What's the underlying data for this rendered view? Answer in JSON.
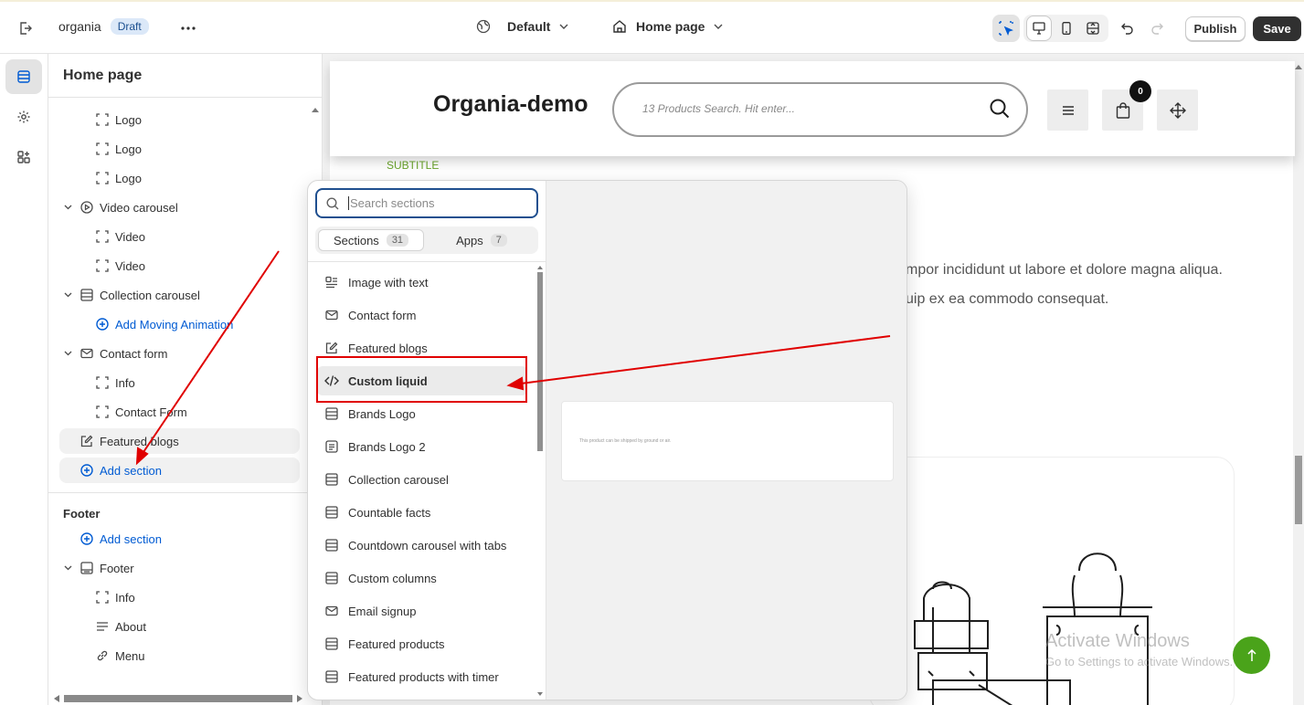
{
  "topbar": {
    "store_name": "organia",
    "status_badge": "Draft",
    "theme_selector": "Default",
    "page_selector": "Home page",
    "publish_label": "Publish",
    "save_label": "Save"
  },
  "sidebar": {
    "title": "Home page",
    "tree": [
      {
        "label": "Logo",
        "icon": "block-icon",
        "level": 2
      },
      {
        "label": "Logo",
        "icon": "block-icon",
        "level": 2
      },
      {
        "label": "Logo",
        "icon": "block-icon",
        "level": 2
      },
      {
        "label": "Video carousel",
        "icon": "play-circle-icon",
        "level": 1,
        "expanded": true
      },
      {
        "label": "Video",
        "icon": "block-icon",
        "level": 2
      },
      {
        "label": "Video",
        "icon": "block-icon",
        "level": 2
      },
      {
        "label": "Collection carousel",
        "icon": "section-icon",
        "level": 1,
        "expanded": true
      },
      {
        "label": "Add Moving Animation",
        "icon": "plus-circle-icon",
        "level": 2,
        "link": true
      },
      {
        "label": "Contact form",
        "icon": "mail-icon",
        "level": 1,
        "expanded": true
      },
      {
        "label": "Info",
        "icon": "block-icon",
        "level": 2
      },
      {
        "label": "Contact Form",
        "icon": "block-icon",
        "level": 2
      },
      {
        "label": "Featured blogs",
        "icon": "edit-icon",
        "level": 1
      },
      {
        "label": "Add section",
        "icon": "plus-circle-icon",
        "level": 1,
        "link": true
      }
    ],
    "footer_heading": "Footer",
    "footer_tree": [
      {
        "label": "Add section",
        "icon": "plus-circle-icon",
        "level": 1,
        "link": true
      },
      {
        "label": "Footer",
        "icon": "footer-icon",
        "level": 1,
        "expanded": true
      },
      {
        "label": "Info",
        "icon": "block-icon",
        "level": 2
      },
      {
        "label": "About",
        "icon": "text-lines-icon",
        "level": 2
      },
      {
        "label": "Menu",
        "icon": "link-icon",
        "level": 2
      }
    ]
  },
  "popup": {
    "search_placeholder": "Search sections",
    "tabs": [
      {
        "label": "Sections",
        "count": "31",
        "active": true
      },
      {
        "label": "Apps",
        "count": "7",
        "active": false
      }
    ],
    "sections": [
      {
        "label": "Image with text",
        "icon": "image-text-icon"
      },
      {
        "label": "Contact form",
        "icon": "mail-icon"
      },
      {
        "label": "Featured blogs",
        "icon": "edit-icon"
      },
      {
        "label": "Custom liquid",
        "icon": "code-icon",
        "hovered": true
      },
      {
        "label": "Brands Logo",
        "icon": "section-icon"
      },
      {
        "label": "Brands Logo 2",
        "icon": "text-box-icon"
      },
      {
        "label": "Collection carousel",
        "icon": "section-icon"
      },
      {
        "label": "Countable facts",
        "icon": "section-icon"
      },
      {
        "label": "Countdown carousel with tabs",
        "icon": "section-icon"
      },
      {
        "label": "Custom columns",
        "icon": "section-icon"
      },
      {
        "label": "Email signup",
        "icon": "mail-icon"
      },
      {
        "label": "Featured products",
        "icon": "section-icon"
      },
      {
        "label": "Featured products with timer",
        "icon": "section-icon"
      }
    ],
    "preview_text": "This product can be shipped by ground or air."
  },
  "store": {
    "brand": "Organia-demo",
    "search_placeholder": "13 Products Search. Hit enter...",
    "cart_count": "0",
    "subtitle": "SUBTITLE",
    "body_line1": "mpor incididunt ut labore et dolore magna aliqua.",
    "body_line2": "uip ex ea commodo consequat."
  },
  "overlay": {
    "watermark_title": "Activate Windows",
    "watermark_sub": "Go to Settings to activate Windows."
  },
  "colors": {
    "accent_blue": "#005bd3",
    "highlight_red": "#e00000",
    "scroll_top_green": "#4aa31a",
    "subtitle_green": "#6aa52a"
  }
}
